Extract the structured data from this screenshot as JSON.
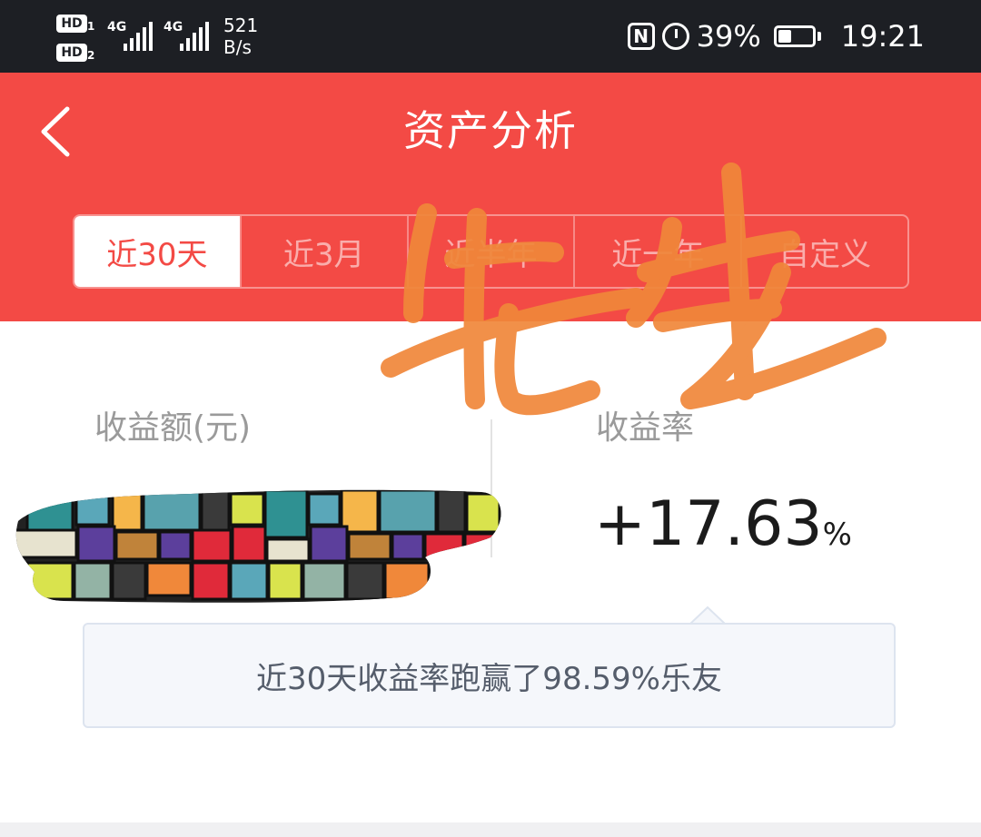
{
  "status_bar": {
    "sim1_label": "HD",
    "sim1_index": "1",
    "sim2_label": "HD",
    "sim2_index": "2",
    "network1": "4G",
    "network2": "4G",
    "speed_value": "521",
    "speed_unit": "B/s",
    "nfc_label": "N",
    "battery_percent": "39%",
    "battery_level": 0.39,
    "time": "19:21"
  },
  "header": {
    "title": "资产分析",
    "background_color": "#f34a45"
  },
  "tabs": [
    {
      "label": "近30天",
      "active": true
    },
    {
      "label": "近3月",
      "active": false
    },
    {
      "label": "近半年",
      "active": false
    },
    {
      "label": "近一年",
      "active": false
    },
    {
      "label": "自定义",
      "active": false
    }
  ],
  "metrics": {
    "income_label": "收益额(元)",
    "rate_label": "收益率",
    "rate_value": "+17.63",
    "rate_unit": "%"
  },
  "tooltip": {
    "text": "近30天收益率跑赢了98.59%乐友"
  },
  "watermark": {
    "text": "先生",
    "color": "#f0873a"
  },
  "icons": {
    "back": "back-chevron-icon",
    "nfc": "nfc-icon",
    "alarm": "alarm-clock-icon",
    "battery": "battery-icon",
    "signal": "signal-bars-icon"
  }
}
